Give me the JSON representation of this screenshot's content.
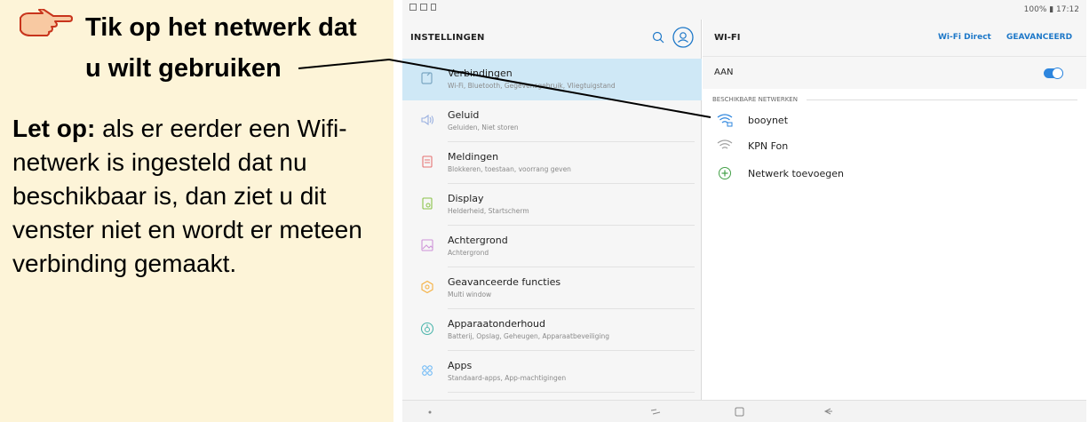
{
  "instructions": {
    "title_line1": "Tik op het netwerk dat",
    "title_line2": "u wilt gebruiken",
    "note_prefix": "Let op:",
    "note_body": " als er eerder een Wifi-netwerk is ingesteld dat nu beschikbaar is, dan ziet u dit venster niet en wordt er meteen verbinding gemaakt."
  },
  "status_bar": {
    "right": "100% ▮ 17:12"
  },
  "settings": {
    "title": "INSTELLINGEN",
    "items": [
      {
        "label": "Verbindingen",
        "sub": "Wi-Fi, Bluetooth, Gegevensgebruik, Vliegtuigstand",
        "icon": "connections-icon",
        "active": true
      },
      {
        "label": "Geluid",
        "sub": "Geluiden, Niet storen",
        "icon": "sound-icon"
      },
      {
        "label": "Meldingen",
        "sub": "Blokkeren, toestaan, voorrang geven",
        "icon": "notifications-icon"
      },
      {
        "label": "Display",
        "sub": "Helderheid, Startscherm",
        "icon": "display-icon"
      },
      {
        "label": "Achtergrond",
        "sub": "Achtergrond",
        "icon": "wallpaper-icon"
      },
      {
        "label": "Geavanceerde functies",
        "sub": "Multi window",
        "icon": "advanced-features-icon"
      },
      {
        "label": "Apparaatonderhoud",
        "sub": "Batterij, Opslag, Geheugen, Apparaatbeveiliging",
        "icon": "device-maintenance-icon"
      },
      {
        "label": "Apps",
        "sub": "Standaard-apps, App-machtigingen",
        "icon": "apps-icon"
      }
    ]
  },
  "wifi": {
    "title": "WI-FI",
    "wifi_direct": "Wi-Fi Direct",
    "advanced": "GEAVANCEERD",
    "state_label": "AAN",
    "state_on": true,
    "section_label": "BESCHIKBARE NETWERKEN",
    "networks": [
      {
        "name": "booynet",
        "secured": true
      },
      {
        "name": "KPN Fon",
        "secured": false
      }
    ],
    "add_network": "Netwerk toevoegen"
  },
  "colors": {
    "accent": "#1e78c8",
    "active_item_bg": "#cfe8f6",
    "instruction_bg": "#fdf4d8"
  }
}
